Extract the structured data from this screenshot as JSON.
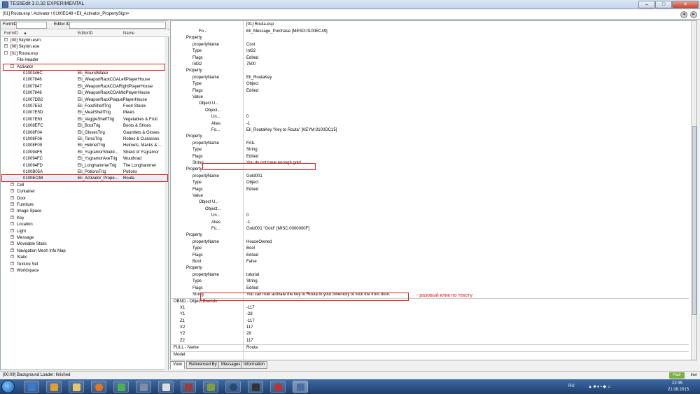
{
  "window": {
    "title": "TES5Edit 3.0.32 EXPERIMENTAL"
  },
  "path": {
    "text": "[01] Routa.esp \\ Activator \\ 0100EC48 <Eli_Activator_PropertySign>",
    "back": "◄",
    "forward": "►"
  },
  "search": {
    "formid_label": "FormID",
    "editorid_label": "Editor ID"
  },
  "left_columns": {
    "formid": "FormID",
    "editorid": "EditorID",
    "name": "Name"
  },
  "tree": [
    {
      "indent": 0,
      "exp": "+",
      "id": "[00] Skyrim.esm",
      "eid": "",
      "name": ""
    },
    {
      "indent": 0,
      "exp": "+",
      "id": "[00] Skyrim.exe",
      "eid": "",
      "name": ""
    },
    {
      "indent": 0,
      "exp": "-",
      "id": "[01] Routa.esp",
      "eid": "",
      "name": ""
    },
    {
      "indent": 1,
      "exp": "",
      "id": "File Header",
      "eid": "",
      "name": ""
    },
    {
      "indent": 1,
      "exp": "-",
      "id": "Activator",
      "eid": "",
      "name": ""
    },
    {
      "indent": 2,
      "exp": "",
      "id": "0100346C",
      "eid": "Eli_RoundWater",
      "name": ""
    },
    {
      "indent": 2,
      "exp": "",
      "id": "01007846",
      "eid": "Eli_WeaponRackCOALeftPlayerHouse",
      "name": ""
    },
    {
      "indent": 2,
      "exp": "",
      "id": "01007847",
      "eid": "Eli_WeaponRackCOARightPlayerHouse",
      "name": ""
    },
    {
      "indent": 2,
      "exp": "",
      "id": "01007848",
      "eid": "Eli_WeaponRackCOAMidPlayerHouse",
      "name": ""
    },
    {
      "indent": 2,
      "exp": "",
      "id": "01007DB2",
      "eid": "Eli_WeaponRackPlaquePlayerHouse",
      "name": ""
    },
    {
      "indent": 2,
      "exp": "",
      "id": "01007E52",
      "eid": "Eli_FoodShelfTrig",
      "name": "Food Stores"
    },
    {
      "indent": 2,
      "exp": "",
      "id": "01007E5D",
      "eid": "Eli_MeatShelfTrig",
      "name": "Meats"
    },
    {
      "indent": 2,
      "exp": "",
      "id": "01007E63",
      "eid": "Eli_VeggieShelfTrig",
      "name": "Vegetables & Fruit"
    },
    {
      "indent": 2,
      "exp": "",
      "id": "01008EFC",
      "eid": "Eli_BootTrig",
      "name": "Boots & Shoes"
    },
    {
      "indent": 2,
      "exp": "",
      "id": "01008F04",
      "eid": "Eli_GlovesTrig",
      "name": "Gauntlets & Gloves"
    },
    {
      "indent": 2,
      "exp": "",
      "id": "01008F06",
      "eid": "Eli_TorsoTrig",
      "name": "Robes & Cuirasses"
    },
    {
      "indent": 2,
      "exp": "",
      "id": "01008F09",
      "eid": "Eli_HelmetTrig",
      "name": "Helmets, Masks & ..."
    },
    {
      "indent": 2,
      "exp": "",
      "id": "010094F5",
      "eid": "Eli_YsgramorShield...",
      "name": "Shield of Ysgramor"
    },
    {
      "indent": 2,
      "exp": "",
      "id": "010094FC",
      "eid": "Eli_YsgramorAxeTrig",
      "name": "Wuuthrad"
    },
    {
      "indent": 2,
      "exp": "",
      "id": "010094FD",
      "eid": "Eli_LonghammerTrig",
      "name": "The Longhammer"
    },
    {
      "indent": 2,
      "exp": "",
      "id": "0100B05A",
      "eid": "Eli_PotionsTrig",
      "name": "Potions"
    },
    {
      "indent": 2,
      "exp": "",
      "id": "0100EC48",
      "eid": "Eli_Activator_Prope...",
      "name": "Routa",
      "selected": true
    },
    {
      "indent": 1,
      "exp": "+",
      "id": "Cell",
      "eid": "",
      "name": ""
    },
    {
      "indent": 1,
      "exp": "+",
      "id": "Container",
      "eid": "",
      "name": ""
    },
    {
      "indent": 1,
      "exp": "+",
      "id": "Door",
      "eid": "",
      "name": ""
    },
    {
      "indent": 1,
      "exp": "+",
      "id": "Furniture",
      "eid": "",
      "name": ""
    },
    {
      "indent": 1,
      "exp": "+",
      "id": "Image Space",
      "eid": "",
      "name": ""
    },
    {
      "indent": 1,
      "exp": "+",
      "id": "Key",
      "eid": "",
      "name": ""
    },
    {
      "indent": 1,
      "exp": "+",
      "id": "Location",
      "eid": "",
      "name": ""
    },
    {
      "indent": 1,
      "exp": "+",
      "id": "Light",
      "eid": "",
      "name": ""
    },
    {
      "indent": 1,
      "exp": "+",
      "id": "Message",
      "eid": "",
      "name": ""
    },
    {
      "indent": 1,
      "exp": "+",
      "id": "Moveable Static",
      "eid": "",
      "name": ""
    },
    {
      "indent": 1,
      "exp": "+",
      "id": "Navigation Mesh Info Map",
      "eid": "",
      "name": ""
    },
    {
      "indent": 1,
      "exp": "+",
      "id": "Static",
      "eid": "",
      "name": ""
    },
    {
      "indent": 1,
      "exp": "+",
      "id": "Texture Set",
      "eid": "",
      "name": ""
    },
    {
      "indent": 1,
      "exp": "+",
      "id": "Worldspace",
      "eid": "",
      "name": ""
    }
  ],
  "right_header": "[01] Routa.esp",
  "records": [
    {
      "indent": 4,
      "label": "Fo...",
      "value": "Eli_Message_Purchase [MESG:0100EC49]"
    },
    {
      "indent": 2,
      "label": "Property",
      "value": ""
    },
    {
      "indent": 3,
      "label": "propertyName",
      "value": "Cost"
    },
    {
      "indent": 3,
      "label": "Type",
      "value": "Int32"
    },
    {
      "indent": 3,
      "label": "Flags",
      "value": "Edited"
    },
    {
      "indent": 3,
      "label": "Int32",
      "value": "7500"
    },
    {
      "indent": 2,
      "label": "Property",
      "value": ""
    },
    {
      "indent": 3,
      "label": "propertyName",
      "value": "Eli_RoutaKey"
    },
    {
      "indent": 3,
      "label": "Type",
      "value": "Object"
    },
    {
      "indent": 3,
      "label": "Flags",
      "value": "Edited"
    },
    {
      "indent": 3,
      "label": "Value",
      "value": ""
    },
    {
      "indent": 4,
      "label": "Object U...",
      "value": ""
    },
    {
      "indent": 5,
      "label": "Object...",
      "value": ""
    },
    {
      "indent": 6,
      "label": "Un...",
      "value": "0"
    },
    {
      "indent": 6,
      "label": "Alias",
      "value": "-1"
    },
    {
      "indent": 6,
      "label": "Fo...",
      "value": "Eli_RoutaKey \"Key to Routa\" [KEYM:0100DC15]"
    },
    {
      "indent": 2,
      "label": "Property",
      "value": ""
    },
    {
      "indent": 3,
      "label": "propertyName",
      "value": "FAIL"
    },
    {
      "indent": 3,
      "label": "Type",
      "value": "String"
    },
    {
      "indent": 3,
      "label": "Flags",
      "value": "Edited"
    },
    {
      "indent": 3,
      "label": "String",
      "value": "You do not have enough gold."
    },
    {
      "indent": 2,
      "label": "Property",
      "value": ""
    },
    {
      "indent": 3,
      "label": "propertyName",
      "value": "Gold001"
    },
    {
      "indent": 3,
      "label": "Type",
      "value": "Object"
    },
    {
      "indent": 3,
      "label": "Flags",
      "value": "Edited"
    },
    {
      "indent": 3,
      "label": "Value",
      "value": ""
    },
    {
      "indent": 4,
      "label": "Object U...",
      "value": ""
    },
    {
      "indent": 5,
      "label": "Object...",
      "value": ""
    },
    {
      "indent": 6,
      "label": "Un...",
      "value": "0"
    },
    {
      "indent": 6,
      "label": "Alias",
      "value": "-1"
    },
    {
      "indent": 6,
      "label": "Fo...",
      "value": "Gold001 \"Gold\" [MISC:0000000F]"
    },
    {
      "indent": 2,
      "label": "Property",
      "value": ""
    },
    {
      "indent": 3,
      "label": "propertyName",
      "value": "HouseOwned"
    },
    {
      "indent": 3,
      "label": "Type",
      "value": "Bool"
    },
    {
      "indent": 3,
      "label": "Flags",
      "value": "Edited"
    },
    {
      "indent": 3,
      "label": "Bool",
      "value": "False"
    },
    {
      "indent": 2,
      "label": "Property",
      "value": ""
    },
    {
      "indent": 3,
      "label": "propertyName",
      "value": "tutorial"
    },
    {
      "indent": 3,
      "label": "Type",
      "value": "String"
    },
    {
      "indent": 3,
      "label": "Flags",
      "value": "Edited"
    },
    {
      "indent": 3,
      "label": "String",
      "value": "You can now activate the key to Routa in your inventory to lock the front door."
    },
    {
      "indent": 0,
      "label": "OBND - Object Bounds",
      "value": ""
    },
    {
      "indent": 1,
      "label": "X1",
      "value": "-117"
    },
    {
      "indent": 1,
      "label": "Y1",
      "value": "-28"
    },
    {
      "indent": 1,
      "label": "Z1",
      "value": "-117"
    },
    {
      "indent": 1,
      "label": "X2",
      "value": "117"
    },
    {
      "indent": 1,
      "label": "Y2",
      "value": "28"
    },
    {
      "indent": 1,
      "label": "Z2",
      "value": "117"
    },
    {
      "indent": 0,
      "label": "FULL - Name",
      "value": "Routa"
    },
    {
      "indent": 0,
      "label": "Model",
      "value": ""
    }
  ],
  "tabs": [
    "View",
    "Referenced By",
    "Messages",
    "Information"
  ],
  "annotation": "- разовый клик по тексту",
  "status": {
    "text": "[00:09] Background Loader: finished",
    "flattr": "Flattr",
    "this": "this!"
  },
  "tray": {
    "lang": "RU",
    "time": "22:35",
    "date": "21.08.2015"
  },
  "colors": {
    "highlight": "#d22222",
    "annotation": "#e02020",
    "taskbar": "#1f3f6e"
  }
}
